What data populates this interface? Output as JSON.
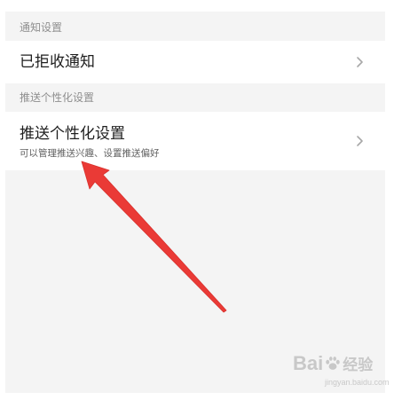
{
  "sections": [
    {
      "header": "通知设置",
      "items": [
        {
          "title": "已拒收通知"
        }
      ]
    },
    {
      "header": "推送个性化设置",
      "items": [
        {
          "title": "推送个性化设置",
          "subtitle": "可以管理推送兴趣、设置推送偏好"
        }
      ]
    }
  ],
  "icons": {
    "row_chevron": "chevron-right-icon",
    "annotation": "red-arrow-icon"
  },
  "colors": {
    "background": "#f4f4f4",
    "row_background": "#ffffff",
    "header_text": "#8f8f8f",
    "title_text": "#1e1e1e",
    "arrow": "#ea3a36"
  },
  "watermark": {
    "brand": "Bai",
    "brand_suffix": "经验",
    "domain": "jingyan.baidu.com"
  }
}
